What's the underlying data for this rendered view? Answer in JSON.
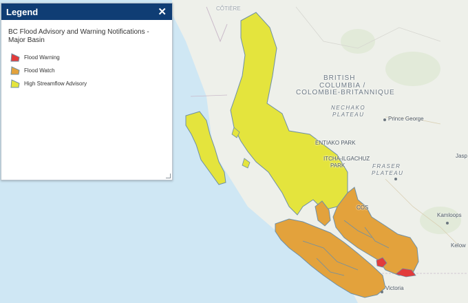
{
  "legend": {
    "title": "Legend",
    "layer_title": "BC Flood Advisory and Warning Notifications - Major Basin",
    "items": [
      {
        "label": "Flood Warning",
        "color": "#e23b3b"
      },
      {
        "label": "Flood Watch",
        "color": "#e3a23c"
      },
      {
        "label": "High Streamflow Advisory",
        "color": "#e4e43d"
      }
    ]
  },
  "map": {
    "colors": {
      "ocean": "#cfe7f4",
      "land": "#eef0ea",
      "advisory": "#e4e43d",
      "watch": "#e3a23c",
      "warning": "#e23b3b",
      "outline": "#6d8fa6"
    },
    "labels": {
      "province_en_1": "BRITISH",
      "province_en_2": "COLUMBIA /",
      "province_fr": "COLOMBIE-BRITANNIQUE",
      "nechako_1": "NECHAKO",
      "nechako_2": "PLATEAU",
      "fraser_1": "FRASER",
      "fraser_2": "PLATEAU",
      "entiako": "ENTIAKO PARK",
      "itcha_1": "ITCHA-ILGACHUZ",
      "itcha_2": "PARK",
      "prince_george": "Prince George",
      "kamloops": "Kamloops",
      "kelowna": "Kelow",
      "jasper": "Jasp",
      "victoria": "Victoria",
      "cos": "COS",
      "cotiere": "CÔTIÈRE"
    }
  }
}
